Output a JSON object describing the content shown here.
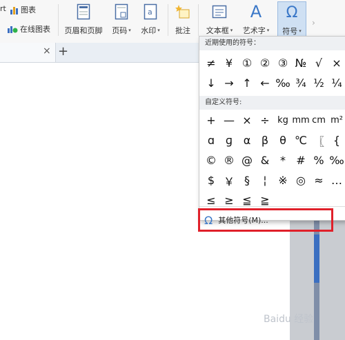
{
  "ribbon": {
    "partial_label": "rt",
    "chart": "图表",
    "online_chart": "在线图表",
    "header_footer": "页眉和页脚",
    "page_number": "页码",
    "watermark": "水印",
    "comment": "批注",
    "text_box": "文本框",
    "art_text": "艺术字",
    "symbol": "符号",
    "symbol_icon_glyph": "Ω",
    "art_text_icon_glyph": "A",
    "caret": "▾",
    "overflow_arrow": "›"
  },
  "tabs": {
    "close_glyph": "×",
    "add_glyph": "+"
  },
  "symbol_panel": {
    "recent_title": "近期使用的符号：",
    "recent_symbols": [
      "≠",
      "¥",
      "①",
      "②",
      "③",
      "№",
      "√",
      "×",
      "↓",
      "→",
      "↑",
      "←",
      "‰",
      "¾",
      "½",
      "¼"
    ],
    "custom_title": "自定义符号:",
    "custom_symbols": [
      "+",
      "—",
      "×",
      "÷",
      "kg",
      "mm",
      "cm",
      "m²",
      "ɑ",
      "ɡ",
      "α",
      "β",
      "θ",
      "℃",
      "〖",
      "{",
      "©",
      "®",
      "@",
      "&",
      "*",
      "#",
      "%",
      "‰",
      "$",
      "￥",
      "§",
      "¦",
      "※",
      "◎",
      "≈",
      "…",
      "≤",
      "≥",
      "≦",
      "≧"
    ],
    "more_symbols": "其他符号(M)...",
    "more_icon": "Ω"
  },
  "watermark": "Baidu 经验"
}
